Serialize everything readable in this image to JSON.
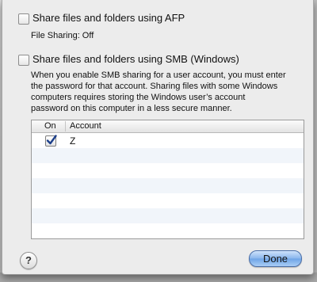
{
  "afp": {
    "label": "Share files and folders using AFP",
    "checked": false,
    "status": "File Sharing: Off"
  },
  "smb": {
    "label": "Share files and folders using SMB (Windows)",
    "checked": false,
    "description_lines": [
      "When you enable SMB sharing for a user account, you must enter",
      "the password for that account. Sharing files with some Windows",
      "computers requires storing the Windows user’s account",
      "password on this computer in a less secure manner."
    ]
  },
  "accounts_table": {
    "columns": [
      "On",
      "Account"
    ],
    "rows": [
      {
        "on": true,
        "account": "Z"
      }
    ]
  },
  "footer": {
    "help_label": "?",
    "done_label": "Done"
  },
  "colors": {
    "sheet": "#ececec",
    "default_button": "#88b5ec",
    "row_stripe": "#f1f5fa"
  }
}
